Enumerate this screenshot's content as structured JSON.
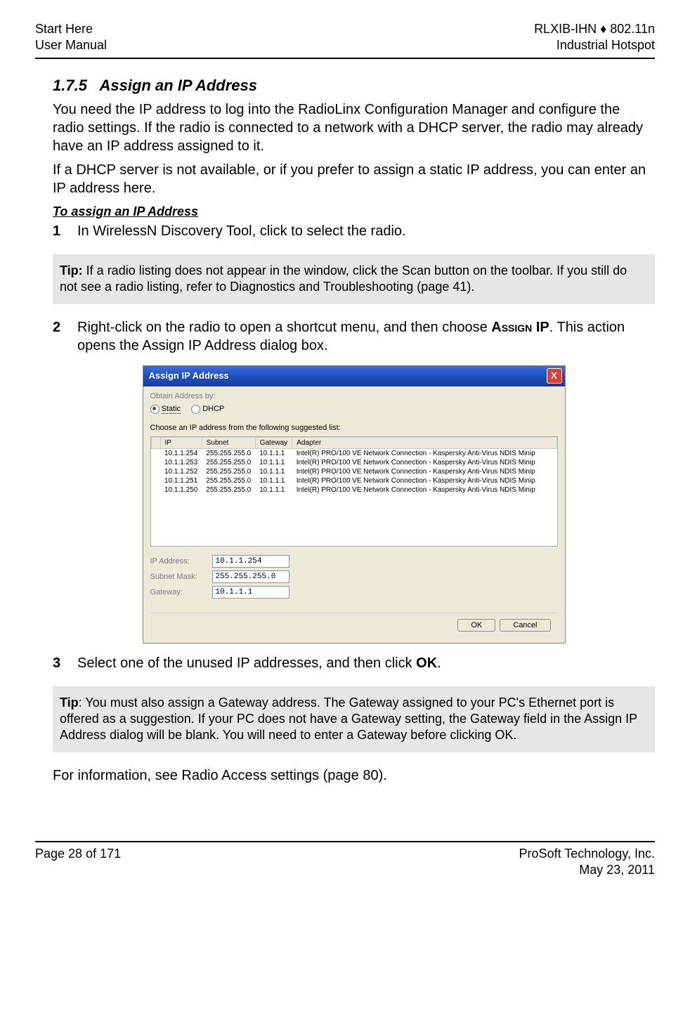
{
  "header": {
    "left1": "Start Here",
    "left2": "User Manual",
    "right1": "RLXIB-IHN ♦ 802.11n",
    "right2": "Industrial Hotspot"
  },
  "section": {
    "number": "1.7.5",
    "title": "Assign an IP Address"
  },
  "para1": "You need the IP address to log into the RadioLinx Configuration Manager and configure the radio settings. If the radio is connected to a network with a DHCP server, the radio may already have an IP address assigned to it.",
  "para2": "If a DHCP server is not available, or if you prefer to assign a static IP address, you can enter an IP address here.",
  "sub_heading": "To assign an IP Address",
  "step1": {
    "num": "1",
    "text": "In WirelessN Discovery Tool, click to select the radio."
  },
  "tip1": {
    "label": "Tip:",
    "text": " If a radio listing does not appear in the window, click the Scan button on the toolbar. If you still do not see a radio listing, refer to Diagnostics and Troubleshooting (page 41)."
  },
  "step2": {
    "num": "2",
    "text_a": "Right-click on the radio to open a shortcut menu, and then choose ",
    "text_b": "Assign IP",
    "text_c": ". This action opens the Assign IP Address dialog box."
  },
  "dialog": {
    "title": "Assign IP Address",
    "close": "X",
    "obtain_label": "Obtain Address by:",
    "radio_static": "Static",
    "radio_dhcp": "DHCP",
    "choose_label": "Choose an IP address from the following suggested list:",
    "headers": [
      "IP",
      "Subnet",
      "Gateway",
      "Adapter"
    ],
    "rows": [
      [
        "10.1.1.254",
        "255.255.255.0",
        "10.1.1.1",
        "Intel(R) PRO/100 VE Network Connection - Kaspersky Anti-Virus NDIS Minip"
      ],
      [
        "10.1.1.253",
        "255.255.255.0",
        "10.1.1.1",
        "Intel(R) PRO/100 VE Network Connection - Kaspersky Anti-Virus NDIS Minip"
      ],
      [
        "10.1.1.252",
        "255.255.255.0",
        "10.1.1.1",
        "Intel(R) PRO/100 VE Network Connection - Kaspersky Anti-Virus NDIS Minip"
      ],
      [
        "10.1.1.251",
        "255.255.255.0",
        "10.1.1.1",
        "Intel(R) PRO/100 VE Network Connection - Kaspersky Anti-Virus NDIS Minip"
      ],
      [
        "10.1.1.250",
        "255.255.255.0",
        "10.1.1.1",
        "Intel(R) PRO/100 VE Network Connection - Kaspersky Anti-Virus NDIS Minip"
      ]
    ],
    "fields": {
      "ip_label": "IP Address:",
      "ip_value": "10.1.1.254",
      "subnet_label": "Subnet Mask:",
      "subnet_value": "255.255.255.0",
      "gateway_label": "Gateway:",
      "gateway_value": "10.1.1.1"
    },
    "ok": "OK",
    "cancel": "Cancel"
  },
  "step3": {
    "num": "3",
    "text_a": "Select one of the unused IP addresses, and then click ",
    "text_b": "OK",
    "text_c": "."
  },
  "tip2": {
    "label": "Tip",
    "text": ": You must also assign a Gateway address. The Gateway assigned to your PC's Ethernet port is offered as a suggestion. If your PC does not have a Gateway setting, the Gateway field in the Assign IP Address dialog will be blank. You will need to enter a Gateway before clicking OK."
  },
  "para_last": "For information, see Radio Access settings (page 80).",
  "footer": {
    "left": "Page 28 of 171",
    "right1": "ProSoft Technology, Inc.",
    "right2": "May 23, 2011"
  }
}
